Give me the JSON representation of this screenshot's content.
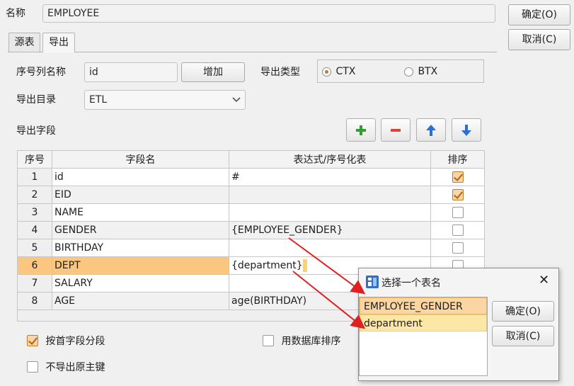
{
  "form": {
    "name_label": "名称",
    "name_value": "EMPLOYEE",
    "ok_button": "确定(O)",
    "cancel_button": "取消(C)"
  },
  "tabs": [
    {
      "label": "源表",
      "active": false
    },
    {
      "label": "导出",
      "active": true
    }
  ],
  "export": {
    "seq_col_label": "序号列名称",
    "seq_col_value": "id",
    "add_button": "增加",
    "type_label": "导出类型",
    "type_options": [
      "CTX",
      "BTX"
    ],
    "type_selected": "CTX",
    "dir_label": "导出目录",
    "dir_value": "ETL",
    "fields_label": "导出字段"
  },
  "table": {
    "headers": [
      "序号",
      "字段名",
      "表达式/序号化表",
      "排序"
    ],
    "rows": [
      {
        "num": "1",
        "name": "id",
        "expr": "#",
        "sort": true
      },
      {
        "num": "2",
        "name": "EID",
        "expr": "",
        "sort": true
      },
      {
        "num": "3",
        "name": "NAME",
        "expr": "",
        "sort": false
      },
      {
        "num": "4",
        "name": "GENDER",
        "expr": "{EMPLOYEE_GENDER}",
        "sort": false
      },
      {
        "num": "5",
        "name": "BIRTHDAY",
        "expr": "",
        "sort": false
      },
      {
        "num": "6",
        "name": "DEPT",
        "expr": "{department}",
        "sort": false
      },
      {
        "num": "7",
        "name": "SALARY",
        "expr": "",
        "sort": false
      },
      {
        "num": "8",
        "name": "AGE",
        "expr": "age(BIRTHDAY)",
        "sort": false
      }
    ]
  },
  "options": {
    "segment_first_field": "按首字段分段",
    "segment_first_field_checked": true,
    "db_sort": "用数据库排序",
    "db_sort_checked": false,
    "no_export_pk": "不导出原主键",
    "no_export_pk_checked": false
  },
  "dialog": {
    "title": "选择一个表名",
    "items": [
      "EMPLOYEE_GENDER",
      "department"
    ],
    "ok_button": "确定(O)",
    "cancel_button": "取消(C)",
    "close_glyph": "✕"
  },
  "icons": {
    "add_row": "plus-icon",
    "delete_row": "minus-icon",
    "move_up": "arrow-up-icon",
    "move_down": "arrow-down-icon",
    "dialog_app": "table-chooser-icon"
  },
  "colors": {
    "selected_row": "#fbc680",
    "accent_orange": "#c87a1b",
    "arrow_red": "#e02020"
  }
}
